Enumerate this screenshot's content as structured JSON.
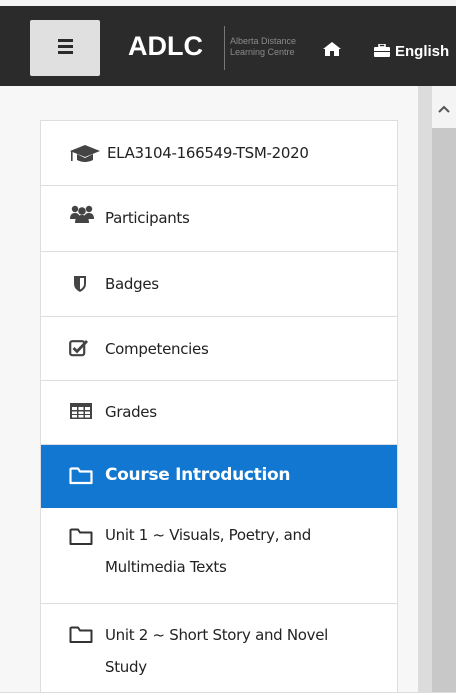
{
  "header": {
    "menu_button_icon": "hamburger-icon",
    "logo_text": "ADLC",
    "logo_subtitle_line1": "Alberta Distance",
    "logo_subtitle_line2": "Learning Centre",
    "home_icon": "home-icon",
    "language_icon": "briefcase-icon",
    "language_label": "English"
  },
  "sidebar": {
    "items": [
      {
        "label": "ELA3104-166549-TSM-2020",
        "icon": "graduation-cap-icon",
        "active": false
      },
      {
        "label": "Participants",
        "icon": "users-icon",
        "active": false
      },
      {
        "label": "Badges",
        "icon": "shield-icon",
        "active": false
      },
      {
        "label": "Competencies",
        "icon": "checkbox-icon",
        "active": false
      },
      {
        "label": "Grades",
        "icon": "table-icon",
        "active": false
      },
      {
        "label": "Course Introduction",
        "icon": "folder-icon",
        "active": true
      },
      {
        "label_line1": "Unit 1 ~ Visuals, Poetry, and",
        "label_line2": "Multimedia Texts",
        "icon": "folder-icon",
        "active": false
      },
      {
        "label_line1": "Unit 2 ~ Short Story and Novel",
        "label_line2": "Study",
        "icon": "folder-icon",
        "active": false
      }
    ]
  },
  "colors": {
    "header_bg": "#2b2b2b",
    "active_item_bg": "#1177d1",
    "page_bg": "#f7f7f7"
  },
  "scrollbar": {
    "up_icon": "chevron-up-icon"
  }
}
